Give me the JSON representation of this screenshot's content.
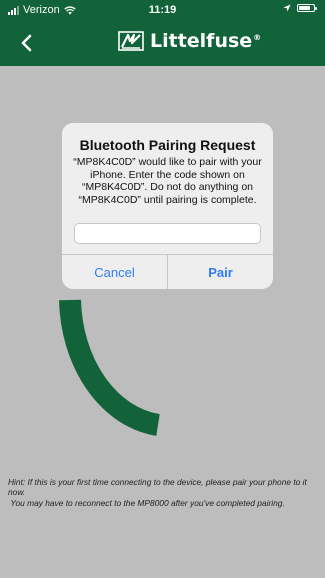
{
  "status_bar": {
    "carrier": "Verizon",
    "time": "11:19",
    "battery_level": 0.75,
    "signal_bars": 3,
    "signal_bars_total": 4
  },
  "header": {
    "back_icon": "chevron-left-icon",
    "logo_text": "Littelfuse",
    "logo_mark": "®"
  },
  "dialog": {
    "title": "Bluetooth Pairing Request",
    "message": "“MP8K4C0D” would like to pair with your iPhone. Enter the code shown on “MP8K4C0D”. Do not do anything on “MP8K4C0D” until pairing is complete.",
    "input_value": "",
    "input_placeholder": "",
    "cancel_label": "Cancel",
    "pair_label": "Pair"
  },
  "hint": {
    "line1": "Hint: If this is your first time connecting to the device, please pair your phone to it now.",
    "line2": " You may have to reconnect to the MP8000 after you've completed pairing."
  },
  "colors": {
    "brand_green": "#12633a",
    "background": "#bdbdbd",
    "link_blue": "#2f7bf5"
  }
}
